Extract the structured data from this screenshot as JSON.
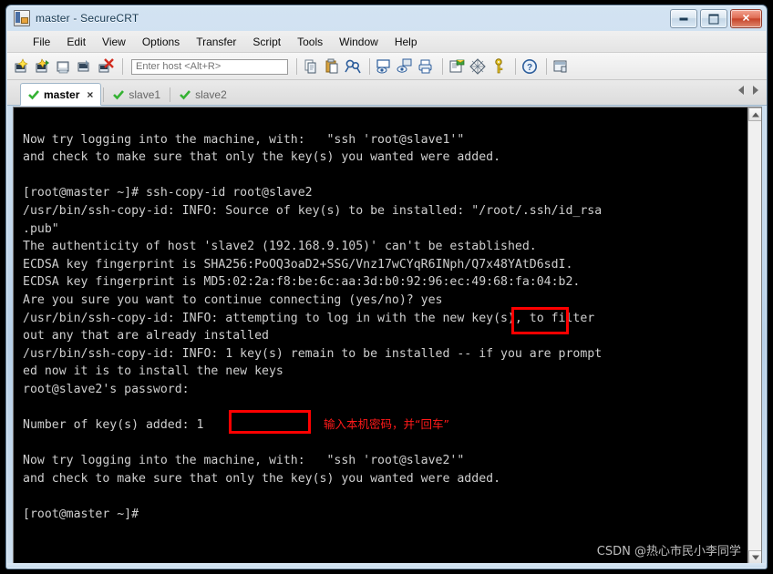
{
  "window": {
    "title": "master - SecureCRT",
    "icon": "securecrt-app-icon",
    "buttons": {
      "minimize": "minimize-window",
      "maximize": "maximize-window",
      "close": "close-window"
    }
  },
  "menubar": {
    "items": [
      {
        "label": "File"
      },
      {
        "label": "Edit"
      },
      {
        "label": "View"
      },
      {
        "label": "Options"
      },
      {
        "label": "Transfer"
      },
      {
        "label": "Script"
      },
      {
        "label": "Tools"
      },
      {
        "label": "Window"
      },
      {
        "label": "Help"
      }
    ]
  },
  "toolbar": {
    "host_placeholder": "Enter host <Alt+R>",
    "host_value": "",
    "icons": [
      "new-session-icon",
      "connect-session-icon",
      "connect-local-shell-icon",
      "connect-sftp-icon",
      "disconnect-icon",
      "copy-icon",
      "paste-icon",
      "find-icon",
      "print-screen-icon",
      "log-session-icon",
      "print-icon",
      "session-options-icon",
      "keymap-editor-icon",
      "key-manager-icon",
      "help-icon",
      "arrange-windows-icon"
    ]
  },
  "tabs": {
    "items": [
      {
        "label": "master",
        "active": true,
        "status": "connected",
        "closable": true
      },
      {
        "label": "slave1",
        "active": false,
        "status": "connected",
        "closable": false
      },
      {
        "label": "slave2",
        "active": false,
        "status": "connected",
        "closable": false
      }
    ],
    "nav_prev": "previous-tab",
    "nav_next": "next-tab"
  },
  "terminal": {
    "lines": [
      "",
      "Now try logging into the machine, with:   \"ssh 'root@slave1'\"",
      "and check to make sure that only the key(s) you wanted were added.",
      "",
      "[root@master ~]# ssh-copy-id root@slave2",
      "/usr/bin/ssh-copy-id: INFO: Source of key(s) to be installed: \"/root/.ssh/id_rsa",
      ".pub\"",
      "The authenticity of host 'slave2 (192.168.9.105)' can't be established.",
      "ECDSA key fingerprint is SHA256:PoOQ3oaD2+SSG/Vnz17wCYqR6INph/Q7x48YAtD6sdI.",
      "ECDSA key fingerprint is MD5:02:2a:f8:be:6c:aa:3d:b0:92:96:ec:49:68:fa:04:b2.",
      "Are you sure you want to continue connecting (yes/no)? yes",
      "/usr/bin/ssh-copy-id: INFO: attempting to log in with the new key(s), to filter",
      "out any that are already installed",
      "/usr/bin/ssh-copy-id: INFO: 1 key(s) remain to be installed -- if you are prompt",
      "ed now it is to install the new keys",
      "root@slave2's password:",
      "",
      "Number of key(s) added: 1",
      "",
      "Now try logging into the machine, with:   \"ssh 'root@slave2'\"",
      "and check to make sure that only the key(s) you wanted were added.",
      "",
      "[root@master ~]#"
    ],
    "watermark": "CSDN @热心市民小李同学"
  },
  "annotations": {
    "highlight_yes": "yes",
    "password_note": "输入本机密码，并“回车”",
    "accent_color": "#ff0000"
  }
}
